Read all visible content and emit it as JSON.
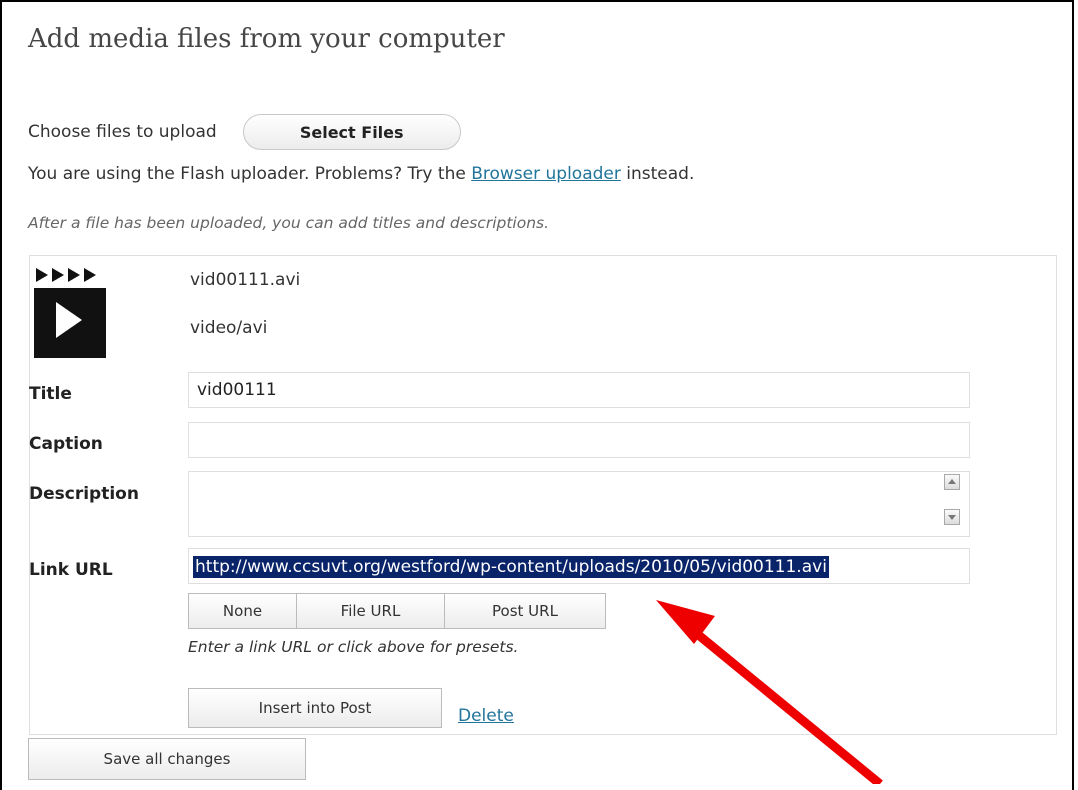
{
  "page": {
    "title": "Add media files from your computer",
    "choose_label": "Choose files to upload",
    "select_files_button": "Select Files",
    "flash_notice_before": "You are using the Flash uploader. Problems? Try the ",
    "flash_notice_link": "Browser uploader",
    "flash_notice_after": " instead.",
    "upload_hint": "After a file has been uploaded, you can add titles and descriptions."
  },
  "media_item": {
    "thumbnail_icon": "video-file-icon",
    "filename": "vid00111.avi",
    "mime_type": "video/avi",
    "fields": {
      "title_label": "Title",
      "title_value": "vid00111",
      "caption_label": "Caption",
      "caption_value": "",
      "description_label": "Description",
      "description_value": "",
      "link_url_label": "Link URL",
      "link_url_value": "http://www.ccsuvt.org/westford/wp-content/uploads/2010/05/vid00111.avi"
    },
    "link_presets": [
      "None",
      "File URL",
      "Post URL"
    ],
    "link_help": "Enter a link URL or click above for presets.",
    "insert_button": "Insert into Post",
    "delete_link": "Delete"
  },
  "footer": {
    "save_button": "Save all changes"
  },
  "colors": {
    "link": "#21759b",
    "selection": "#0a246a",
    "annotation_arrow": "#ee0000"
  }
}
